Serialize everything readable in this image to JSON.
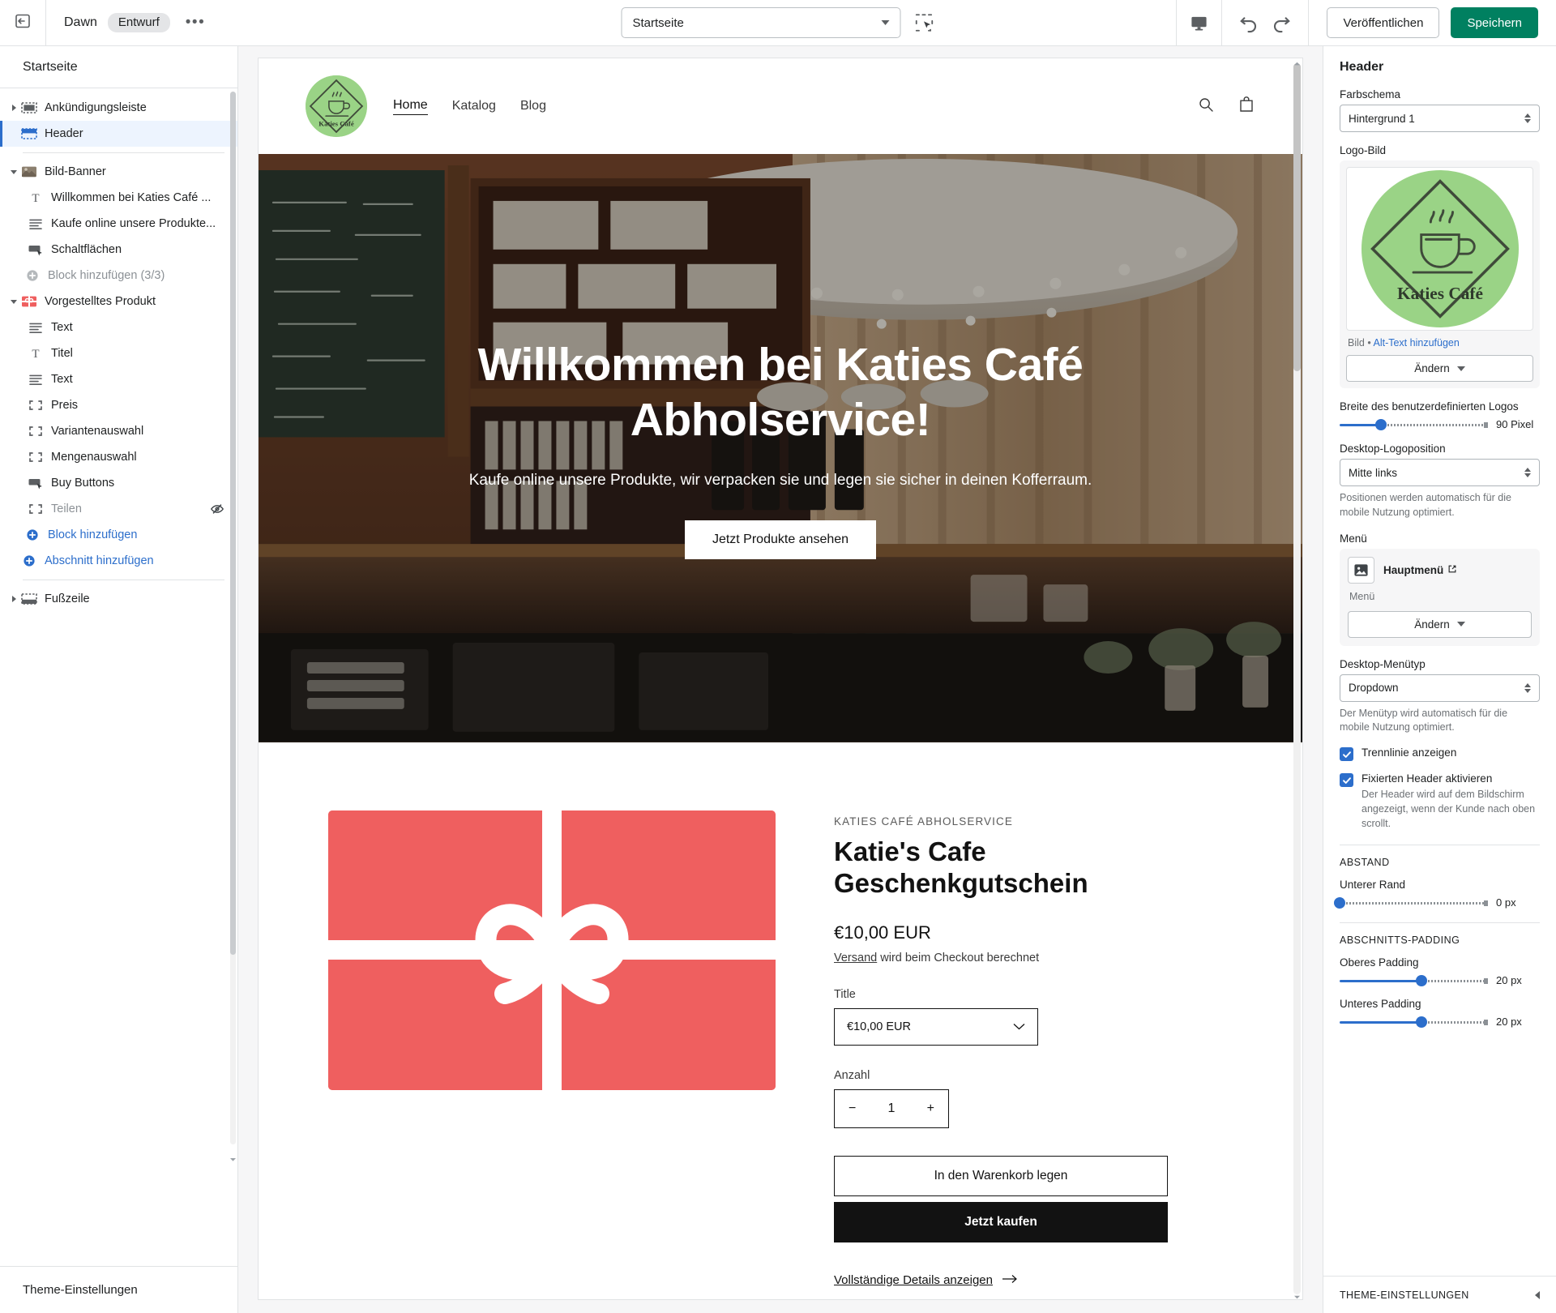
{
  "topbar": {
    "exit_icon": "exit-icon",
    "theme_name": "Dawn",
    "status_badge": "Entwurf",
    "more_icon": "more-dots-icon",
    "page_selector_value": "Startseite",
    "inspect_icon": "inspector-select-icon",
    "device_icon": "desktop-monitor-icon",
    "undo_icon": "undo-arrow-icon",
    "redo_icon": "redo-arrow-icon",
    "publish_label": "Veröffentlichen",
    "save_label": "Speichern",
    "save_color": "#008060"
  },
  "sidebar": {
    "title": "Startseite",
    "footer_label": "Theme-Einstellungen",
    "items": [
      {
        "label": "Ankündigungsleiste",
        "icon": "announcement-bar-icon",
        "level": 0,
        "toggle": "right",
        "state": "normal"
      },
      {
        "label": "Header",
        "icon": "header-block-icon",
        "level": 0,
        "toggle": "none",
        "state": "selected"
      },
      {
        "label": "Bild-Banner",
        "icon": "image-banner-icon",
        "level": 0,
        "toggle": "down",
        "state": "normal"
      },
      {
        "label": "Willkommen bei Katies Café ...",
        "icon": "heading-text-icon",
        "level": 1,
        "toggle": "none",
        "state": "normal"
      },
      {
        "label": "Kaufe online unsere Produkte...",
        "icon": "paragraph-text-icon",
        "level": 1,
        "toggle": "none",
        "state": "normal"
      },
      {
        "label": "Schaltflächen",
        "icon": "buttons-icon",
        "level": 1,
        "toggle": "none",
        "state": "normal"
      },
      {
        "label": "Block hinzufügen (3/3)",
        "icon": "plus-circle-muted-icon",
        "level": 1,
        "toggle": "none",
        "state": "muted"
      },
      {
        "label": "Vorgestelltes Produkt",
        "icon": "featured-product-icon",
        "level": 0,
        "toggle": "down",
        "state": "normal"
      },
      {
        "label": "Text",
        "icon": "paragraph-text-icon",
        "level": 1,
        "toggle": "none",
        "state": "normal"
      },
      {
        "label": "Titel",
        "icon": "heading-text-icon",
        "level": 1,
        "toggle": "none",
        "state": "normal"
      },
      {
        "label": "Text",
        "icon": "paragraph-text-icon",
        "level": 1,
        "toggle": "none",
        "state": "normal"
      },
      {
        "label": "Preis",
        "icon": "block-placeholder-icon",
        "level": 1,
        "toggle": "none",
        "state": "normal"
      },
      {
        "label": "Variantenauswahl",
        "icon": "block-placeholder-icon",
        "level": 1,
        "toggle": "none",
        "state": "normal"
      },
      {
        "label": "Mengenauswahl",
        "icon": "block-placeholder-icon",
        "level": 1,
        "toggle": "none",
        "state": "normal"
      },
      {
        "label": "Buy Buttons",
        "icon": "buttons-icon",
        "level": 1,
        "toggle": "none",
        "state": "normal"
      },
      {
        "label": "Teilen",
        "icon": "block-placeholder-icon",
        "level": 1,
        "toggle": "none",
        "state": "hidden"
      },
      {
        "label": "Block hinzufügen",
        "icon": "plus-circle-blue-icon",
        "level": 1,
        "toggle": "none",
        "state": "link"
      },
      {
        "label": "Abschnitt hinzufügen",
        "icon": "plus-circle-blue-icon",
        "level": 0,
        "toggle": "none",
        "state": "link"
      },
      {
        "label": "Fußzeile",
        "icon": "footer-block-icon",
        "level": 0,
        "toggle": "right",
        "state": "normal"
      }
    ]
  },
  "preview": {
    "store": {
      "logo_text": "Katies Café",
      "logo_bg": "#9ad386",
      "nav": [
        {
          "label": "Home",
          "active": true
        },
        {
          "label": "Katalog",
          "active": false
        },
        {
          "label": "Blog",
          "active": false
        }
      ],
      "search_icon": "search-icon",
      "cart_icon": "shopping-bag-icon"
    },
    "hero": {
      "heading": "Willkommen bei Katies Café Abholservice!",
      "subheading": "Kaufe online unsere Produkte, wir verpacken sie und legen sie sicher in deinen Kofferraum.",
      "button_label": "Jetzt Produkte ansehen"
    },
    "product": {
      "image_alt": "gift-card-image",
      "image_bg": "#ef5f5f",
      "vendor": "KATIES CAFÉ ABHOLSERVICE",
      "title": "Katie's Cafe Geschenkgutschein",
      "price": "€10,00 EUR",
      "shipping_link": "Versand",
      "shipping_rest": " wird beim Checkout berechnet",
      "variant_label": "Title",
      "variant_value": "€10,00 EUR",
      "quantity_label": "Anzahl",
      "quantity_value": "1",
      "minus_icon": "minus-icon",
      "plus_icon": "plus-icon",
      "add_to_cart_label": "In den Warenkorb legen",
      "buy_now_label": "Jetzt kaufen",
      "details_label": "Vollständige Details anzeigen",
      "details_arrow_icon": "arrow-right-icon"
    }
  },
  "rightpanel": {
    "title": "Header",
    "color_scheme_label": "Farbschema",
    "color_scheme_value": "Hintergrund 1",
    "logo_image_label": "Logo-Bild",
    "logo_alt_prefix": "Bild • ",
    "logo_alt_link": "Alt-Text hinzufügen",
    "logo_change_label": "Ändern",
    "logo_width_label": "Breite des benutzerdefinierten Logos",
    "logo_width_value": "90 Pixel",
    "logo_width_pct": 28,
    "logo_position_label": "Desktop-Logoposition",
    "logo_position_value": "Mitte links",
    "logo_position_help": "Positionen werden automatisch für die mobile Nutzung optimiert.",
    "menu_label": "Menü",
    "menu_name": "Hauptmenü",
    "menu_external_icon": "external-link-icon",
    "menu_thumb_icon": "image-placeholder-icon",
    "menu_sub": "Menü",
    "menu_change_label": "Ändern",
    "menu_type_label": "Desktop-Menütyp",
    "menu_type_value": "Dropdown",
    "menu_type_help": "Der Menütyp wird automatisch für die mobile Nutzung optimiert.",
    "checkbox_divider_label": "Trennlinie anzeigen",
    "checkbox_divider_checked": true,
    "checkbox_sticky_label": "Fixierten Header aktivieren",
    "checkbox_sticky_checked": true,
    "checkbox_sticky_help": "Der Header wird auf dem Bildschirm angezeigt, wenn der Kunde nach oben scrollt.",
    "spacing_section": "ABSTAND",
    "bottom_margin_label": "Unterer Rand",
    "bottom_margin_value": "0 px",
    "bottom_margin_pct": 0,
    "padding_section": "ABSCHNITTS-PADDING",
    "top_padding_label": "Oberes Padding",
    "top_padding_value": "20 px",
    "top_padding_pct": 55,
    "bottom_padding_label": "Unteres Padding",
    "bottom_padding_value": "20 px",
    "bottom_padding_pct": 55,
    "footer_label": "THEME-EINSTELLUNGEN",
    "footer_icon": "chevron-left-icon",
    "accent_color": "#2c6ecb"
  }
}
